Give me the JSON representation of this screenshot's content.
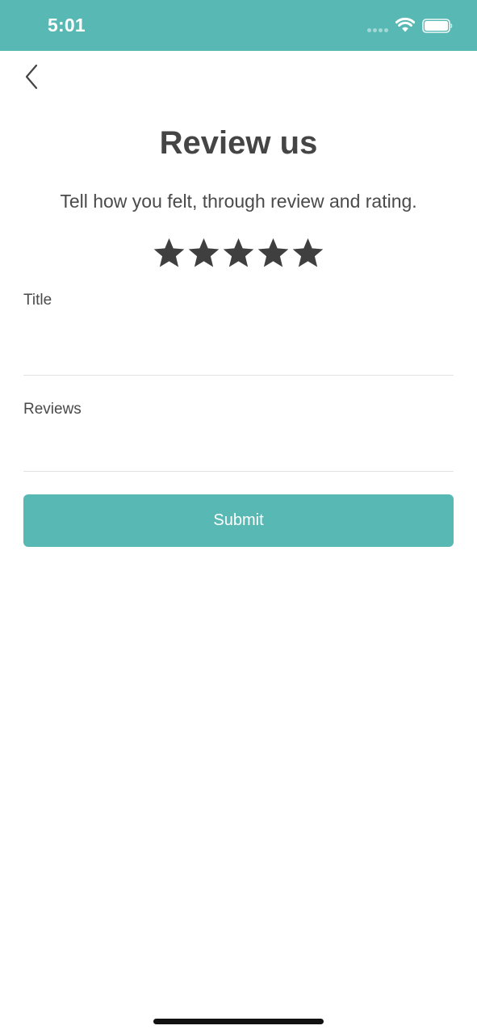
{
  "status_bar": {
    "time": "5:01",
    "background_color": "#58b9b4",
    "icons": [
      "signal-dots-icon",
      "wifi-icon",
      "battery-icon"
    ]
  },
  "nav": {
    "back_icon": "chevron-left-icon"
  },
  "header": {
    "title": "Review us",
    "subtitle": "Tell how you felt, through review and rating."
  },
  "rating": {
    "max": 5,
    "value": 5,
    "star_color": "#3f3f3f",
    "icon": "star-icon"
  },
  "form": {
    "title_field": {
      "label": "Title",
      "value": "",
      "placeholder": ""
    },
    "reviews_field": {
      "label": "Reviews",
      "value": "",
      "placeholder": ""
    },
    "submit_label": "Submit",
    "accent_color": "#58b9b4"
  }
}
